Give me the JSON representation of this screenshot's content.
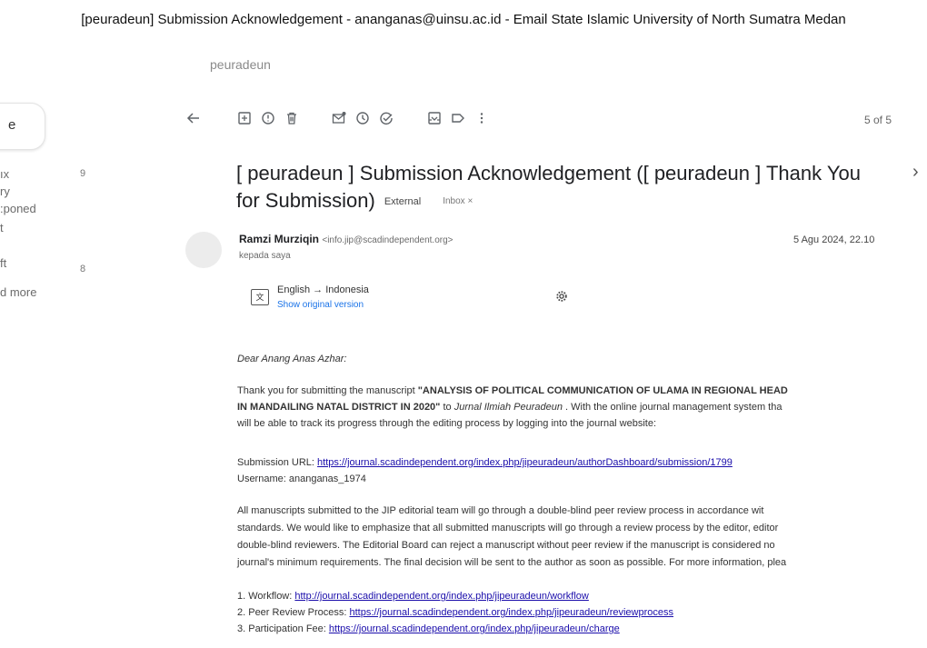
{
  "window_title": "[peuradeun] Submission Acknowledgement - ananganas@uinsu.ac.id - Email State Islamic University of North Sumatra Medan",
  "breadcrumb": "peuradeun",
  "sidebar": {
    "compose_label": "e",
    "items": [
      {
        "label": "ıx",
        "count": "9"
      },
      {
        "label": "ry",
        "count": ""
      },
      {
        "label": ":poned",
        "count": ""
      },
      {
        "label": "t",
        "count": ""
      },
      {
        "label": "ft",
        "count": "8"
      },
      {
        "label": "d more",
        "count": ""
      }
    ]
  },
  "toolbar": {
    "icons": [
      "back-arrow-icon",
      "archive-icon",
      "report-spam-icon",
      "delete-icon",
      "mark-unread-icon",
      "snooze-icon",
      "add-task-icon",
      "move-to-icon",
      "label-icon",
      "more-vert-icon"
    ],
    "pager": "5 of 5"
  },
  "email": {
    "subject_line1": "[ peuradeun ] Submission Acknowledgement ([ peuradeun ] Thank You",
    "subject_line2": "for Submission)",
    "external_label": "External",
    "inbox_label": "Inbox ×",
    "sender_name": "Ramzi Murziqin",
    "sender_email": "<info.jip@scadindependent.org>",
    "to_me": "kepada saya",
    "date": "5 Agu 2024, 22.10",
    "translate_lang": "English → Indonesia",
    "translate_link": "Show original version",
    "greeting": "Dear Anang Anas Azhar:",
    "p1_line1_a": "Thank you for submitting the manuscript ",
    "p1_line1_b": "\"ANALYSIS OF POLITICAL COMMUNICATION OF ULAMA IN REGIONAL HEAD",
    "p1_line2_a": "IN MANDAILING NATAL DISTRICT IN 2020\"",
    "p1_line2_b": " to ",
    "p1_line2_c": "Jurnal Ilmiah Peuradeun",
    "p1_line2_d": " . With the online journal management system tha",
    "p1_line3": "will be able to track its progress through the editing process by logging into the journal website:",
    "submission_url_label": "Submission URL: ",
    "submission_url": "https://journal.scadindependent.org/index.php/jipeuradeun/authorDashboard/submission/1799",
    "username_line": "Username: ananganas_1974",
    "p2_line1": "All manuscripts submitted to the JIP editorial team will go through a double-blind peer review process in accordance wit",
    "p2_line2": "standards. We would like to emphasize that all submitted manuscripts will go through a review process by the editor, editor",
    "p2_line3": "double-blind reviewers. The Editorial Board can reject a manuscript without peer review if the manuscript is considered no",
    "p2_line4": "journal's minimum requirements. The final decision will be sent to the author as soon as possible. For more information, plea",
    "links": [
      {
        "label": "1. Workflow: ",
        "url": "http://journal.scadindependent.org/index.php/jipeuradeun/workflow"
      },
      {
        "label": "2. Peer Review Process: ",
        "url": "https://journal.scadindependent.org/index.php/jipeuradeun/reviewprocess"
      },
      {
        "label": "3. Participation Fee: ",
        "url": "https://journal.scadindependent.org/index.php/jipeuradeun/charge"
      }
    ]
  }
}
